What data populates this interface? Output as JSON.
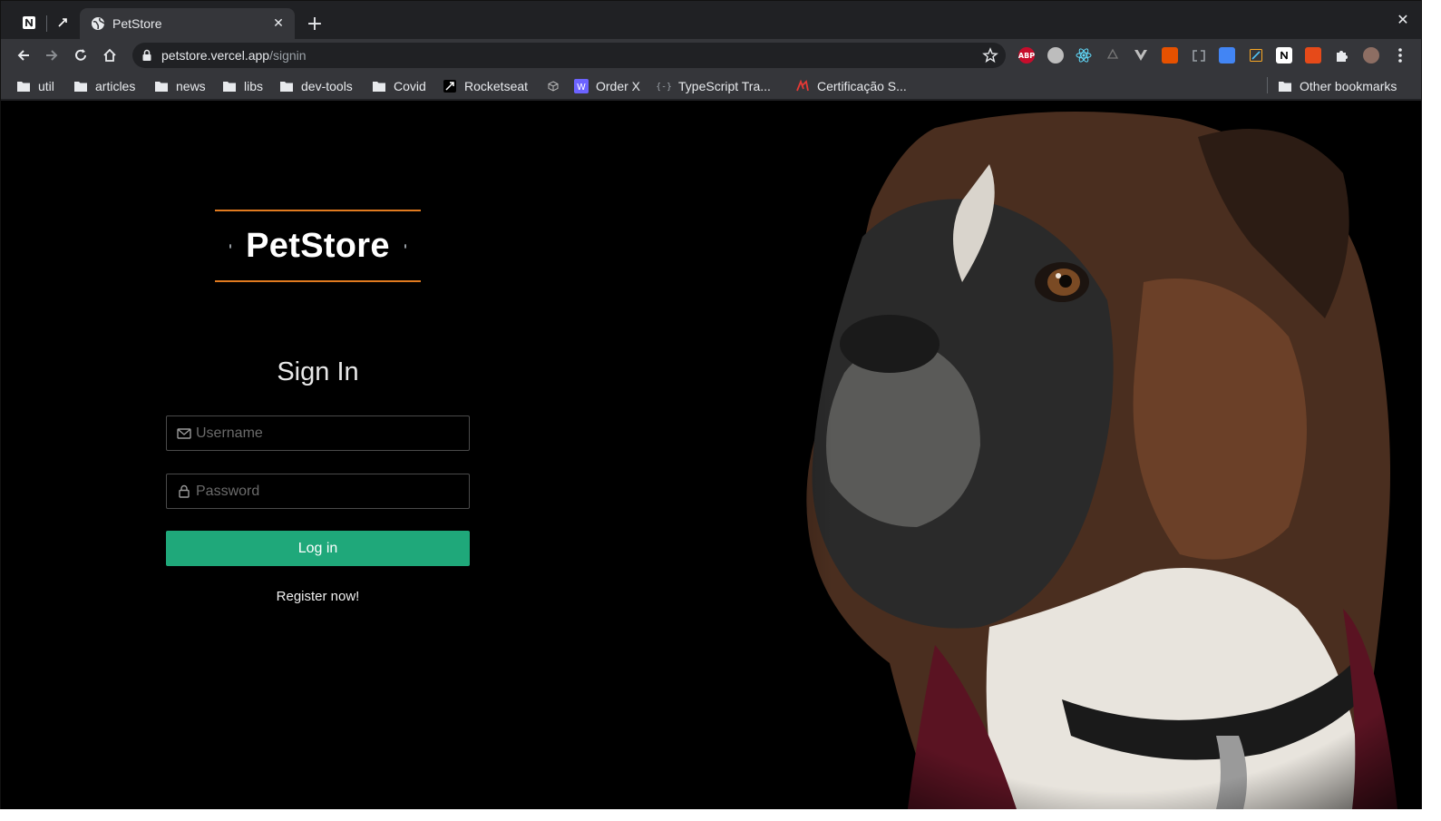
{
  "browser": {
    "active_tab_title": "PetStore",
    "url_host": "petstore.vercel.app",
    "url_path": "/signin",
    "bookmarks": [
      {
        "label": "util",
        "icon": "folder-icon"
      },
      {
        "label": "articles",
        "icon": "folder-icon"
      },
      {
        "label": "news",
        "icon": "folder-icon"
      },
      {
        "label": "libs",
        "icon": "folder-icon"
      },
      {
        "label": "dev-tools",
        "icon": "folder-icon"
      },
      {
        "label": "Covid",
        "icon": "folder-icon"
      },
      {
        "label": "Rocketseat",
        "icon": "rocketseat-icon"
      },
      {
        "label": "",
        "icon": "codesandbox-icon"
      },
      {
        "label": "Order X",
        "icon": "order-x-icon"
      },
      {
        "label": "TypeScript Tra...",
        "icon": "typescript-icon"
      },
      {
        "label": "Certificação S...",
        "icon": "certificacao-icon"
      }
    ],
    "other_bookmarks": "Other bookmarks",
    "extensions": [
      {
        "label": "ABP",
        "icon": "adblock-plus-icon"
      },
      {
        "label": "",
        "icon": "octotree-icon"
      },
      {
        "label": "",
        "icon": "react-devtools-icon"
      },
      {
        "label": "",
        "icon": "recycle-icon"
      },
      {
        "label": "",
        "icon": "vue-devtools-icon"
      },
      {
        "label": "",
        "icon": "extension-orange-icon"
      },
      {
        "label": "",
        "icon": "clipboard-icon"
      },
      {
        "label": "",
        "icon": "google-translate-icon"
      },
      {
        "label": "",
        "icon": "edit-icon"
      },
      {
        "label": "",
        "icon": "notion-icon"
      },
      {
        "label": "",
        "icon": "extension-red-icon"
      },
      {
        "label": "",
        "icon": "puzzle-icon"
      }
    ]
  },
  "page": {
    "logo": "PetStore",
    "title": "Sign In",
    "username_placeholder": "Username",
    "password_placeholder": "Password",
    "login_label": "Log in",
    "register_label": "Register now!"
  },
  "colors": {
    "accent_orange": "#e07a1f",
    "button_green": "#1fa87a",
    "page_bg": "#000000"
  }
}
